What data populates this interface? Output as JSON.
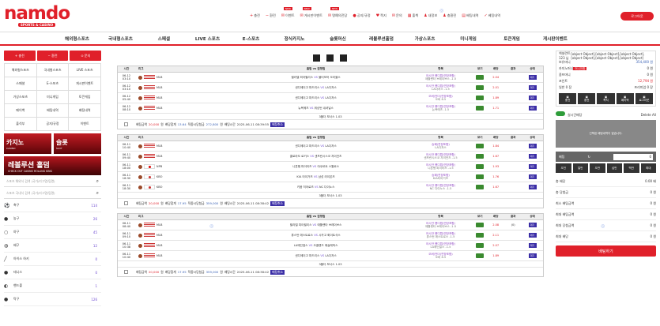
{
  "header": {
    "logo_text": "namdo",
    "logo_sub": "SPORTS & CASINO",
    "menu": [
      {
        "icon": "plus-icon",
        "label": "충전",
        "new": false
      },
      {
        "icon": "minus-icon",
        "label": "환전",
        "new": false
      },
      {
        "icon": "gift-icon",
        "label": "이벤트",
        "new": true
      },
      {
        "icon": "game-icon",
        "label": "게시판이벤트",
        "new": true
      },
      {
        "icon": "game-icon",
        "label": "명예의전당",
        "new": true
      },
      {
        "icon": "info-icon",
        "label": "공지/규정",
        "new": false
      },
      {
        "icon": "heart-icon",
        "label": "쪽지",
        "new": false
      },
      {
        "icon": "question-icon",
        "label": "문의",
        "new": false
      },
      {
        "icon": "calendar-icon",
        "label": "출첵",
        "new": false
      },
      {
        "icon": "user-icon",
        "label": "내정보",
        "new": false
      },
      {
        "icon": "cash-icon",
        "label": "충환전",
        "new": false
      },
      {
        "icon": "list-icon",
        "label": "배팅내역",
        "new": false
      },
      {
        "icon": "check-icon",
        "label": "베팅내역",
        "new": false
      }
    ],
    "new_badge": "NEW",
    "logout": "로그아웃"
  },
  "nav": [
    "해외형스포츠",
    "국내형스포츠",
    "스페셜",
    "LIVE 스포츠",
    "E-스포츠",
    "정식카지노",
    "슬롯머신",
    "레볼루션홀덤",
    "가상스포츠",
    "미니게임",
    "토큰게임",
    "게시판이벤트"
  ],
  "left": {
    "quick": [
      "+ 충전",
      "− 환전",
      "⊙ 문의"
    ],
    "grid": [
      "해외형스포츠",
      "국내형스포츠",
      "LIVE 스포츠",
      "스페셜",
      "E-스포츠",
      "게시판이벤트",
      "가상스포츠",
      "미니게임",
      "토큰게임",
      "페이백",
      "배팅내역",
      "배팅내역",
      "출석부",
      "공지/규정",
      "이벤트"
    ],
    "banner_casino": "카지노",
    "banner_casino_sub": "CASINO",
    "banner_slot": "슬롯",
    "banner_slot_sub": "SLOT",
    "banner_holdem": "레볼루션 홀덤",
    "banner_holdem_sub": "CHECK OUT CASINO ROLLING KING",
    "search1": "스포츠 해외식 검색 (국가/리그명/팀명)",
    "search2": "스포츠 국내식 검색 (국가/리그명/팀명)",
    "sports": [
      {
        "icon": "soccer-icon",
        "name": "축구",
        "count": "114"
      },
      {
        "icon": "basketball-icon",
        "name": "농구",
        "count": "26"
      },
      {
        "icon": "baseball-icon",
        "name": "야구",
        "count": "45"
      },
      {
        "icon": "volleyball-icon",
        "name": "배구",
        "count": "12"
      },
      {
        "icon": "hockey-icon",
        "name": "아이스 하키",
        "count": "0"
      },
      {
        "icon": "tennis-icon",
        "name": "테니스",
        "count": "0"
      },
      {
        "icon": "handball-icon",
        "name": "핸드볼",
        "count": "1"
      },
      {
        "icon": "tabletennis-icon",
        "name": "탁구",
        "count": "126"
      }
    ]
  },
  "table_headers": [
    "시간",
    "리그",
    "홈팀 vs 원정팀",
    "항목",
    "보기",
    "배당",
    "결과",
    "상태"
  ],
  "groups": [
    {
      "rows": [
        {
          "time1": "06-12",
          "time2": "03:10",
          "flag": "us",
          "league": "MLB",
          "home": "필라델 피아필리스",
          "away": "볼티모어 오리올스",
          "m1": "아시안 핸디캡(연장포함)",
          "m2": "애틀랜타 브레이브스 -1.5",
          "odd": "2.04",
          "state": "대기"
        },
        {
          "time1": "06-12",
          "time2": "03:10",
          "flag": "us",
          "league": "MLB",
          "home": "샌디에이고 파드리스",
          "away": "LA다저스",
          "m1": "아시안 핸디캡(연장포함)",
          "m2": "LA다저스 -1.5",
          "odd": "2.01",
          "state": "대기"
        },
        {
          "time1": "06-12",
          "time2": "05:40",
          "flag": "us",
          "league": "MLB",
          "home": "샌디에이고 파드리스",
          "away": "LA다저스",
          "m1": "오버/언더(연장포함)",
          "m2": "오버 8.5",
          "odd": "1.89",
          "state": "대기"
        },
        {
          "time1": "06-12",
          "time2": "08:10",
          "flag": "us",
          "league": "MLB",
          "home": "뉴욕메츠",
          "away": "워싱턴 내셔널스",
          "m1": "아시안 핸디캡(연장포함)",
          "m2": "뉴욕메츠 -1.5",
          "odd": "1.71",
          "state": "대기"
        }
      ],
      "bonus": "3폴더 보너스 1.03",
      "sum": {
        "amount": "20,000",
        "odds": "13.64",
        "win": "272,800",
        "time": "2025-06-11 08:39:55"
      }
    },
    {
      "rows": [
        {
          "time1": "06-11",
          "time2": "10:40",
          "flag": "us",
          "league": "MLB",
          "home": "샌디에이고 파드리스",
          "away": "LA다저스",
          "m1": "승패(연장포함)",
          "m2": "LA다저스",
          "odd": "1.84",
          "state": "대기"
        },
        {
          "time1": "06-11",
          "time2": "09:40",
          "flag": "us",
          "league": "MLB",
          "home": "콜로라도 로키스",
          "away": "샌프란시스코 자이언츠",
          "m1": "아시안 핸디캡(연장포함)",
          "m2": "샌프란시스코 자이언츠 -1.5",
          "odd": "1.67",
          "state": "대기"
        },
        {
          "time1": "06-11",
          "time2": "18:00",
          "flag": "jp",
          "league": "NPB",
          "home": "니혼햄 파이터즈",
          "away": "야쿠르트 스왈로스",
          "m1": "아시안 핸디캡(연장포함)",
          "m2": "니혼햄 파이터즈 -1.5",
          "odd": "1.93",
          "state": "대기"
        },
        {
          "time1": "06-11",
          "time2": "18:30",
          "flag": "kr",
          "league": "KBO",
          "home": "KIA 타이거즈",
          "away": "삼성 라이온즈",
          "m1": "승패(연장포함)",
          "m2": "KIA타이거즈",
          "odd": "1.76",
          "state": "대기"
        },
        {
          "time1": "06-11",
          "time2": "18:30",
          "flag": "kr",
          "league": "KBO",
          "home": "키움 히어로즈",
          "away": "NC 다이노스",
          "m1": "아시안 핸디캡(연장포함)",
          "m2": "NC 다이노스 -1.5",
          "odd": "1.67",
          "state": "대기"
        }
      ],
      "bonus": "3폴더 보너스 1.03",
      "sum": {
        "amount": "20,000",
        "odds": "17.95",
        "win": "359,000",
        "time": "2025-06-11 08:38:42"
      }
    },
    {
      "rows": [
        {
          "time1": "06-11",
          "time2": "08:40",
          "flag": "us",
          "league": "MLB",
          "home": "필라델 피아필리스",
          "away": "애틀랜타 브레이브스",
          "m1": "아시안 핸디캡(연장포함)",
          "m2": "애틀랜타 브레이브스 -1.5",
          "odd": "2.08",
          "result": "(0)",
          "state": "대기"
        },
        {
          "time1": "06-11",
          "time2": "09:10",
          "flag": "us",
          "league": "MLB",
          "home": "휴스턴 애스트로스",
          "away": "시카고 화이트삭스",
          "m1": "아시안 핸디캡(연장포함)",
          "m2": "휴스턴 애스트로스 -1.5",
          "odd": "2.11",
          "state": "대기"
        },
        {
          "time1": "06-11",
          "time2": "10:38",
          "flag": "us",
          "league": "MLB",
          "home": "LA에인절스",
          "away": "오클랜드 애슬레틱스",
          "m1": "아시안 핸디캡(연장포함)",
          "m2": "LA에인절스 -1.5",
          "odd": "2.07",
          "state": "대기"
        },
        {
          "time1": "06-11",
          "time2": "10:40",
          "flag": "us",
          "league": "MLB",
          "home": "샌디에이고 파드리스",
          "away": "LA다저스",
          "m1": "오버/언더(연장포함)",
          "m2": "오버 8.5",
          "odd": "1.89",
          "state": "대기"
        }
      ],
      "bonus": "3폴더 보너스 1.03",
      "sum": {
        "amount": "20,000",
        "odds": "17.95",
        "win": "359,000",
        "time": "2025-06-11 08:38:42"
      }
    }
  ],
  "sum_labels": {
    "amount": "배팅금액",
    "odds": "배당합계",
    "win": "적중시당첨금",
    "time": "배팅시간",
    "won": "원",
    "del": "배팅취소"
  },
  "vs": "VS",
  "right": {
    "user": "엑설런트123 님",
    "info": [
      {
        "label": "총 배당",
        "value": "0.00 배"
      },
      {
        "label": "총 당첨금",
        "value": "0 원"
      },
      {
        "label": "최소 배팅금액",
        "value": "0 원"
      },
      {
        "label": "최대 배팅금액",
        "value": "0 원"
      },
      {
        "label": "최대 당첨금액",
        "value": "0 원"
      },
      {
        "label": "최대 배당",
        "value": "0 원"
      }
    ],
    "lines": [
      {
        "label": "보유머니",
        "value": "354,400",
        "unit": "원",
        "cls": "blue"
      },
      {
        "label": "카지노머니",
        "tag": "머니전환",
        "value": "0",
        "unit": "원",
        "cls": ""
      },
      {
        "label": "콤프머니",
        "value": "0",
        "unit": "원",
        "cls": ""
      },
      {
        "label": "포인트",
        "value": "12,794",
        "unit": "원",
        "cls": "red"
      },
      {
        "label": "일반 0 장",
        "value": "프리미엄 0 장",
        "unit": "",
        "cls": ""
      }
    ],
    "gbtns": [
      "충전",
      "환전",
      "쪽지",
      "페이백",
      "로그아웃"
    ],
    "toggle": "실시간배당",
    "delete": "Delete All",
    "empty": "선택된 배팅내역이 없습니다.",
    "bet_label": "배팅",
    "bet_value": "0",
    "quick": [
      "오천",
      "일만",
      "오만",
      "십만",
      "백만",
      "최대"
    ],
    "go": "배팅하기"
  }
}
